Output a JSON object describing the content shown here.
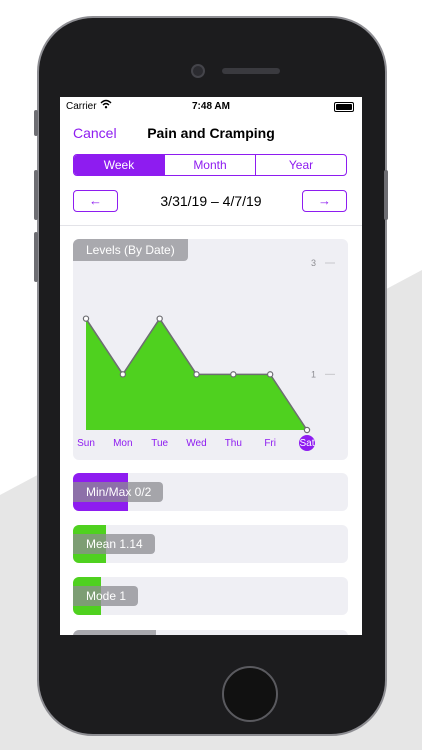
{
  "colors": {
    "accent": "#8e1cf0",
    "area": "#4fd11f"
  },
  "status": {
    "carrier": "Carrier",
    "time": "7:48 AM",
    "wifi_icon": "wifi-icon",
    "battery_icon": "battery-icon"
  },
  "nav": {
    "cancel": "Cancel",
    "title": "Pain and Cramping"
  },
  "segments": [
    {
      "label": "Week",
      "selected": true
    },
    {
      "label": "Month",
      "selected": false
    },
    {
      "label": "Year",
      "selected": false
    }
  ],
  "date_nav": {
    "prev": "←",
    "next": "→",
    "range": "3/31/19 – 4/7/19"
  },
  "chart_card": {
    "label": "Levels (By Date)"
  },
  "chart_data": {
    "type": "area",
    "categories": [
      "Sun",
      "Mon",
      "Tue",
      "Wed",
      "Thu",
      "Fri",
      "Sat"
    ],
    "values": [
      2,
      1,
      2,
      1,
      1,
      1,
      0
    ],
    "ylim": [
      0,
      3
    ],
    "y_ticks": [
      "3",
      "1"
    ],
    "selected_category": "Sat"
  },
  "stats": [
    {
      "label": "Min/Max 0/2",
      "fraction": 0.2,
      "color": "#8e1cf0"
    },
    {
      "label": "Mean 1.14",
      "fraction": 0.12,
      "color": "#4fd11f"
    },
    {
      "label": "Mode 1",
      "fraction": 0.1,
      "color": "#4fd11f"
    }
  ]
}
